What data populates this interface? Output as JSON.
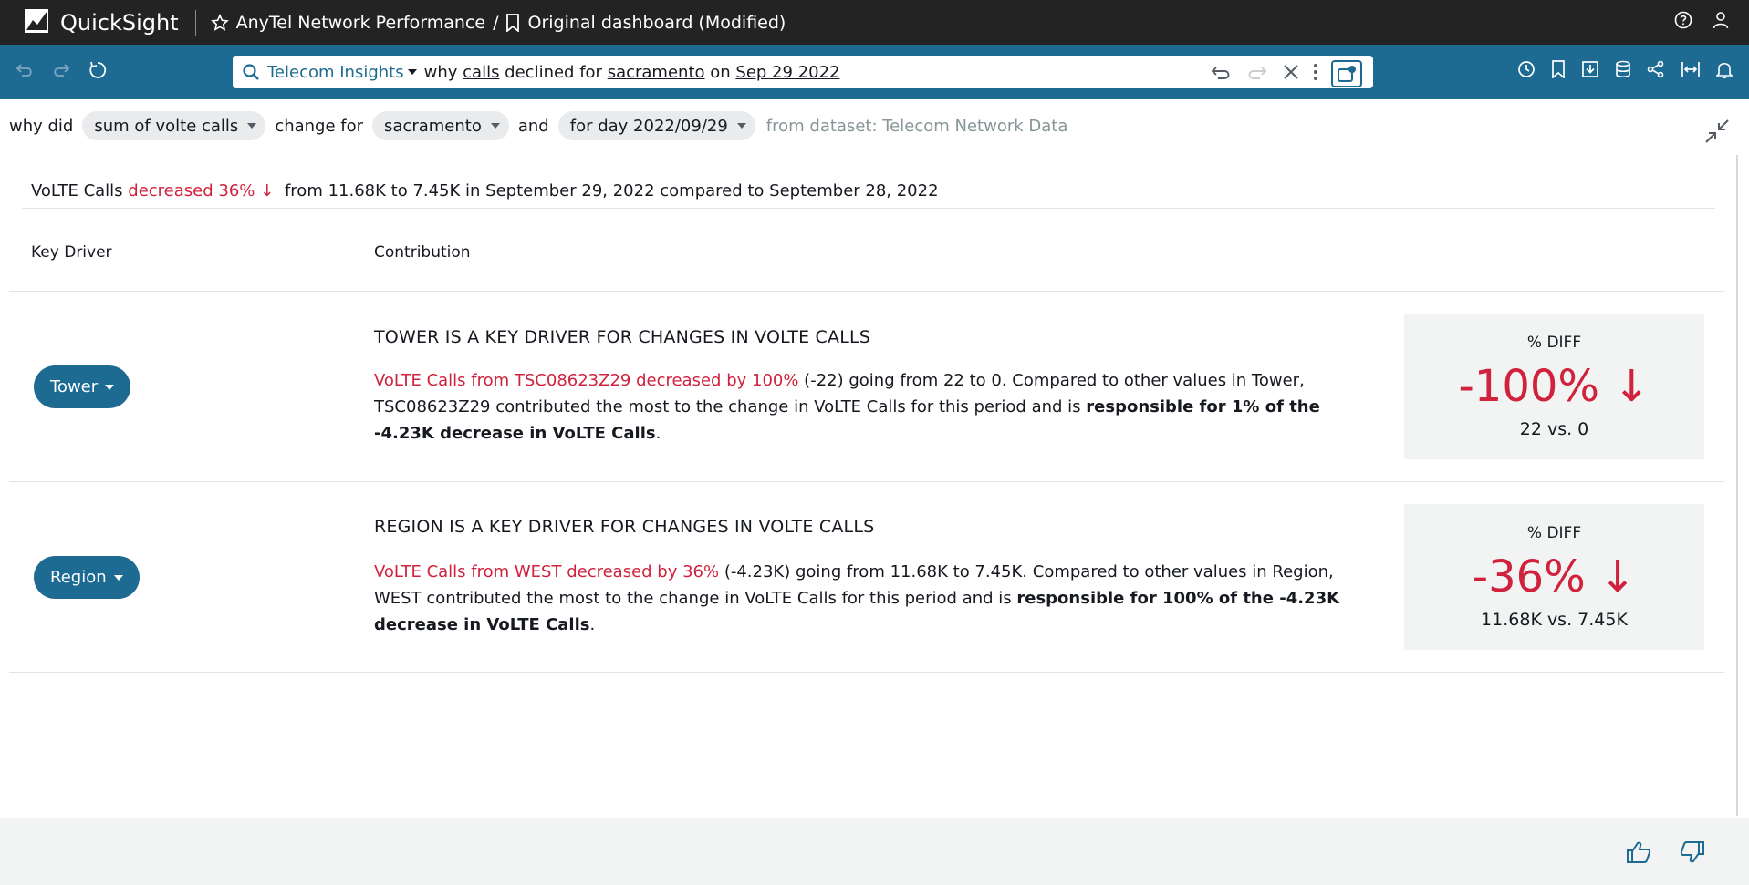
{
  "app": {
    "name": "QuickSight"
  },
  "breadcrumb": {
    "dashboard": "AnyTel Network Performance",
    "separator": "/",
    "sheet": "Original dashboard (Modified)"
  },
  "icons": {
    "logo": "quicksight-logo-icon",
    "favorite": "star-icon",
    "bookmark": "bookmark-icon",
    "help": "help-icon",
    "user": "user-icon",
    "undo": "undo-icon",
    "redo": "redo-icon",
    "reset": "reset-icon",
    "search": "search-icon",
    "clear": "close-icon",
    "more": "more-vertical-icon",
    "clock": "clock-icon",
    "download": "download-icon",
    "dataset": "database-icon",
    "share": "share-icon",
    "fit-width": "fit-width-icon",
    "alerts": "bell-icon",
    "collapse": "collapse-icon",
    "thumbs-up": "thumbs-up-icon",
    "thumbs-down": "thumbs-down-icon"
  },
  "search": {
    "topic": "Telecom Insights",
    "query_parts": [
      "why ",
      "calls",
      " declined for ",
      "sacramento",
      " on ",
      "Sep 29 2022"
    ]
  },
  "interpretation": {
    "why_did": "why did",
    "measure": "sum of volte calls",
    "change_for": "change for",
    "filter": "sacramento",
    "and": "and",
    "date": "for day 2022/09/29",
    "dataset": "from dataset: Telecom Network Data"
  },
  "summary": {
    "metric": "VoLTE Calls",
    "change": "decreased 36%",
    "arrow": "↓",
    "rest": "from 11.68K to 7.45K in September 29, 2022 compared to September 28, 2022"
  },
  "table": {
    "col_driver": "Key Driver",
    "col_contribution": "Contribution"
  },
  "drivers": [
    {
      "button": "Tower",
      "title": "TOWER IS A KEY DRIVER FOR CHANGES IN VOLTE CALLS",
      "red_text": "VoLTE Calls from TSC08623Z29 decreased by 100%",
      "text": " (-22) going from 22 to 0. Compared to other values in Tower, TSC08623Z29 contributed the most to the change in VoLTE Calls for this period and is ",
      "bold_text": "responsible for 1% of the -4.23K decrease in VoLTE Calls",
      "end": ".",
      "diff_label": "% DIFF",
      "diff_value": "-100%",
      "diff_arrow": "↓",
      "diff_compare": "22 vs. 0"
    },
    {
      "button": "Region",
      "title": "REGION IS A KEY DRIVER FOR CHANGES IN VOLTE CALLS",
      "red_text": "VoLTE Calls from WEST decreased by 36%",
      "text": " (-4.23K) going from 11.68K to 7.45K. Compared to other values in Region, WEST contributed the most to the change in VoLTE Calls for this period and is ",
      "bold_text": "responsible for 100% of the -4.23K decrease in VoLTE Calls",
      "end": ".",
      "diff_label": "% DIFF",
      "diff_value": "-36%",
      "diff_arrow": "↓",
      "diff_compare": "11.68K vs. 7.45K"
    }
  ],
  "colors": {
    "brand": "#1d6a93",
    "topbar": "#232323",
    "negative": "#d0223d",
    "panel": "#f2f3f3"
  }
}
